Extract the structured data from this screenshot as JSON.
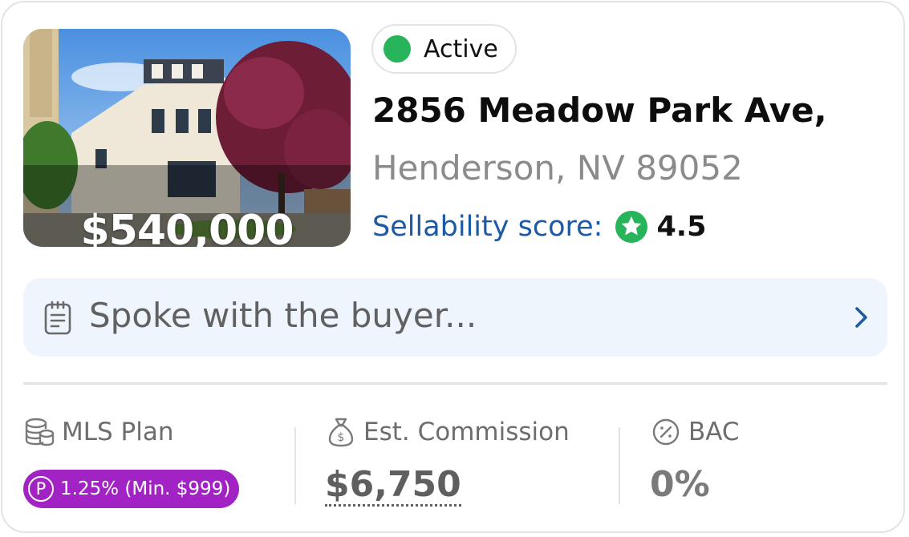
{
  "listing": {
    "price": "$540,000",
    "status": "Active",
    "street": "2856 Meadow Park Ave,",
    "city": "Henderson, NV 89052",
    "sellability_label": "Sellability score:",
    "sellability_value": "4.5",
    "status_color": "#27b45a"
  },
  "note": {
    "text": "Spoke with the buyer..."
  },
  "metrics": {
    "mls_plan": {
      "label": "MLS Plan",
      "badge_icon": "P",
      "badge_text": "1.25% (Min. $999)"
    },
    "commission": {
      "label": "Est. Commission",
      "value": "$6,750"
    },
    "bac": {
      "label": "BAC",
      "value": "0%"
    }
  },
  "icons": {
    "status": "status-dot-icon",
    "score": "star-badge-icon",
    "note": "note-icon",
    "chevron": "chevron-right-icon",
    "mls": "coins-stack-icon",
    "commission": "money-bag-icon",
    "bac": "percent-badge-icon"
  },
  "colors": {
    "accent_blue": "#1c5aa5",
    "note_bg": "#eef5fd",
    "plan_badge": "#a223c3",
    "green": "#27b45a"
  }
}
